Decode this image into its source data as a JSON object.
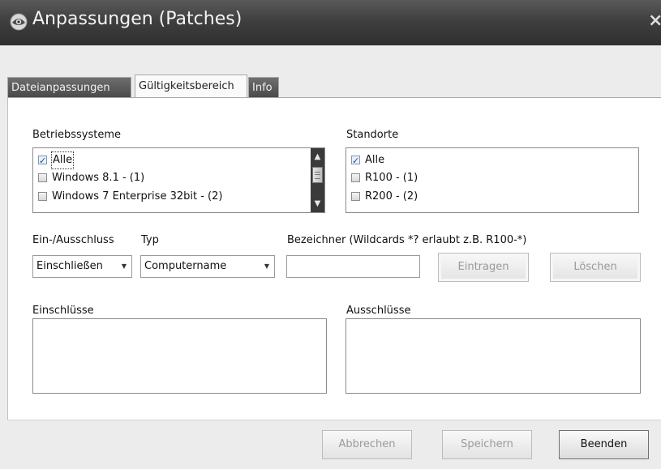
{
  "window": {
    "title": "Anpassungen (Patches)",
    "close_glyph": "×",
    "app_icon": "eye-globe-icon"
  },
  "tabs": [
    {
      "label": "Dateianpassungen",
      "active": false
    },
    {
      "label": "Gültigkeitsbereich",
      "active": true
    },
    {
      "label": "Info",
      "active": false
    }
  ],
  "os_list": {
    "label": "Betriebssysteme",
    "items": [
      {
        "label": "Alle",
        "checked": true
      },
      {
        "label": "Windows 8.1 - (1)",
        "checked": false
      },
      {
        "label": "Windows 7 Enterprise 32bit - (2)",
        "checked": false
      }
    ]
  },
  "site_list": {
    "label": "Standorte",
    "items": [
      {
        "label": "Alle",
        "checked": true
      },
      {
        "label": "R100 - (1)",
        "checked": false
      },
      {
        "label": "R200 - (2)",
        "checked": false
      }
    ]
  },
  "filter": {
    "inout_label": "Ein-/Ausschluss",
    "inout_value": "Einschließen",
    "type_label": "Typ",
    "type_value": "Computername",
    "identifier_label": "Bezeichner (Wildcards *?  erlaubt z.B. R100-*)",
    "identifier_value": "",
    "add_button": "Eintragen",
    "delete_button": "Löschen"
  },
  "includes": {
    "label": "Einschlüsse"
  },
  "excludes": {
    "label": "Ausschlüsse"
  },
  "footer": {
    "cancel": "Abbrechen",
    "save": "Speichern",
    "close": "Beenden"
  },
  "colors": {
    "titlebar": "#3f3f3f",
    "checkbox_check": "#2a4d84"
  }
}
